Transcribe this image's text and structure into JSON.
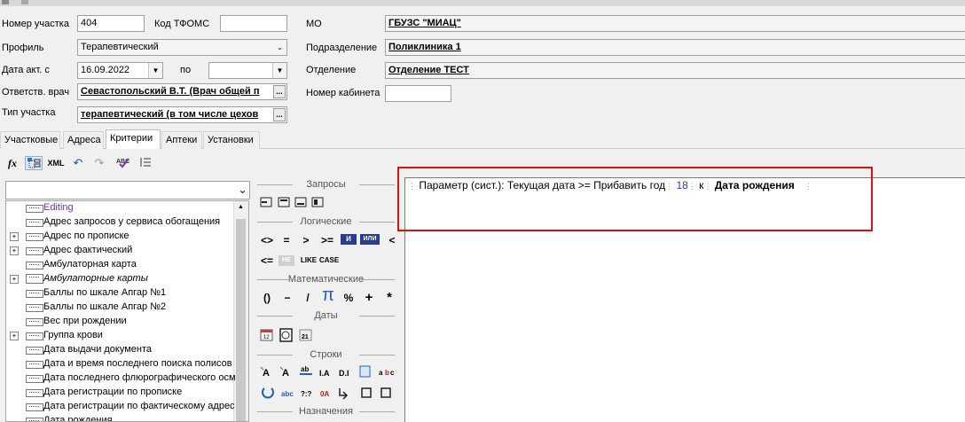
{
  "form": {
    "uchastok_label": "Номер участка",
    "uchastok_value": "404",
    "tfoms_label": "Код ТФОМС",
    "tfoms_value": "",
    "profile_label": "Профиль",
    "profile_value": "Терапевтический",
    "date_label": "Дата акт.  с",
    "date_from": "16.09.2022",
    "date_to_label": "по",
    "date_to": "",
    "doctor_label": "Ответств. врач",
    "doctor_value": "Севастопольский В.Т. (Врач общей п",
    "type_label": "Тип участка",
    "type_value": "терапевтический (в том числе цехов",
    "mo_label": "МО",
    "mo_value": "ГБУЗС \"МИАЦ\"",
    "podr_label": "Подразделение",
    "podr_value": "Поликлиника 1",
    "otdel_label": "Отделение",
    "otdel_value": "Отделение ТЕСТ",
    "cabinet_label": "Номер кабинета",
    "cabinet_value": ""
  },
  "tabs": [
    "Участковые",
    "Адреса",
    "Критерии",
    "Аптеки",
    "Установки"
  ],
  "toolbar": {
    "fx": "fx",
    "xml": "XML"
  },
  "tree": {
    "items": [
      {
        "label": "Editing",
        "color": "#7030a0"
      },
      {
        "label": "Адрес запросов у сервиса обогащения"
      },
      {
        "label": "Адрес по прописке"
      },
      {
        "label": "Адрес фактический"
      },
      {
        "label": "Амбулаторная карта"
      },
      {
        "label": "Амбулаторные карты"
      },
      {
        "label": "Баллы по шкале Апгар №1"
      },
      {
        "label": "Баллы по шкале Апгар №2"
      },
      {
        "label": "Вес при рождении"
      },
      {
        "label": "Группа крови"
      },
      {
        "label": "Дата выдачи документа"
      },
      {
        "label": "Дата и время последнего поиска полисов"
      },
      {
        "label": "Дата последнего флюрографического осм"
      },
      {
        "label": "Дата регистрации по прописке"
      },
      {
        "label": "Дата регистрации по фактическому адрес"
      },
      {
        "label": "Дата рождения"
      }
    ]
  },
  "palette": {
    "sec_queries": "Запросы",
    "sec_logic": "Логические",
    "sec_math": "Математические",
    "sec_dates": "Даты",
    "sec_strings": "Строки",
    "sec_assign": "Назначения",
    "logic_ops_row1": [
      "<>",
      "=",
      ">",
      ">=",
      "И",
      "ИЛИ",
      "<"
    ],
    "logic_ops_row2": [
      "<=",
      "НЕ",
      "LIKE",
      "CASE"
    ],
    "math_ops": [
      "()",
      "−",
      "/",
      "π",
      "%",
      "+",
      "*"
    ]
  },
  "expression": {
    "param": "Параметр (сист.): Текущая дата",
    "op": ">=",
    "func": "Прибавить год",
    "num": "18",
    "k": "к",
    "field": "Дата рождения"
  },
  "colors": {
    "highlight": "#e01010",
    "number": "#1a3cc8",
    "logic_btn": "#2b3a8c"
  }
}
